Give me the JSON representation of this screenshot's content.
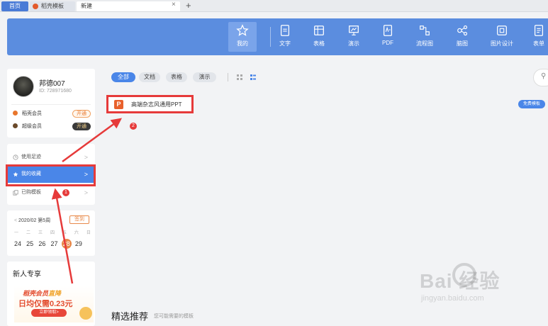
{
  "tabs": {
    "home": "首页",
    "docer": "稻壳模板",
    "new": "新建",
    "close": "×",
    "add": "+"
  },
  "nav": {
    "items": [
      {
        "label": "我的",
        "icon": "star-icon",
        "active": true
      },
      {
        "label": "文字",
        "icon": "document-icon"
      },
      {
        "label": "表格",
        "icon": "spreadsheet-icon"
      },
      {
        "label": "演示",
        "icon": "presentation-icon"
      },
      {
        "label": "PDF",
        "icon": "pdf-icon"
      },
      {
        "label": "流程图",
        "icon": "flowchart-icon"
      },
      {
        "label": "脑图",
        "icon": "mindmap-icon"
      },
      {
        "label": "图片设计",
        "icon": "image-design-icon"
      },
      {
        "label": "表单",
        "icon": "form-icon"
      }
    ]
  },
  "profile": {
    "name": "邦德007",
    "id": "ID: 728971680",
    "memberships": [
      {
        "label": "稻壳会员",
        "action": "开通"
      },
      {
        "label": "超级会员",
        "action": "开通"
      }
    ]
  },
  "menu": {
    "items": [
      {
        "label": "使用足迹",
        "icon": "clock-icon"
      },
      {
        "label": "我的收藏",
        "icon": "star-icon",
        "active": true
      },
      {
        "label": "已购模板",
        "icon": "copy-icon"
      }
    ]
  },
  "calendar": {
    "header": "2020/02 第5周",
    "sign_label": "签到",
    "weekdays": [
      "一",
      "二",
      "三",
      "四",
      "五",
      "六",
      "日"
    ],
    "days": [
      "24",
      "25",
      "26",
      "27",
      "28",
      "29"
    ],
    "today": "28"
  },
  "promo": {
    "title": "新人专享",
    "ad_brand": "稻壳会员",
    "ad_hot": "直降",
    "ad_price": "日均仅需0.23元",
    "ad_button": "立即领取>"
  },
  "filters": {
    "items": [
      {
        "label": "全部",
        "active": true
      },
      {
        "label": "文档"
      },
      {
        "label": "表格"
      },
      {
        "label": "演示"
      }
    ]
  },
  "template": {
    "title": "高端杂志风通用PPT",
    "icon_letter": "P",
    "badge": "免费模板"
  },
  "recommend": {
    "title": "精选推荐",
    "subtitle": "您可能需要的模板"
  },
  "annotations": {
    "marker1": "1",
    "marker2": "2",
    "color": "#e63a3a"
  },
  "watermark": {
    "main": "Bai  经验",
    "sub": "jingyan.baidu.com"
  },
  "colors": {
    "header_blue": "#5b8ddf",
    "active_blue": "#4a86e8",
    "accent_orange": "#e8894a"
  }
}
